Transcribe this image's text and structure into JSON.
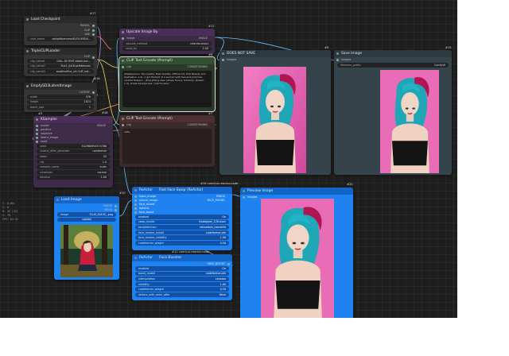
{
  "status_overlay": [
    "T: 0.00s",
    "I: 0",
    "N: 42 [42]",
    "V: 79",
    "FPS: 64.52"
  ],
  "nodes": {
    "load_checkpoint": {
      "id": "#17",
      "title": "Load Checkpoint",
      "outputs": [
        "MODEL",
        "CLIP",
        "VAE"
      ],
      "ckpt_label": "ckpt_name",
      "ckpt_value": "sdxlpdfpersonalXLFLUXSDX...",
      "colors": {
        "accent": "#8a8a8a"
      }
    },
    "triple_clip": {
      "id": "#16",
      "title": "TripleCLIPLoader",
      "output": "CLIP",
      "widgets": [
        {
          "label": "clip_name1",
          "value": "t5XL-1B-TEXT-detail.enc..."
        },
        {
          "label": "clip_name2",
          "value": "flux1_fp16.safetensors"
        },
        {
          "label": "clip_name3",
          "value": "sosdlineflux_vit-CLIP_saf..."
        }
      ]
    },
    "empty_latent": {
      "id": "#18",
      "title": "EmptySD3LatentImage",
      "output": "LATENT",
      "widgets": [
        {
          "label": "width",
          "value": "576"
        },
        {
          "label": "height",
          "value": "1024"
        },
        {
          "label": "batch_size",
          "value": "1"
        }
      ]
    },
    "upscale_by": {
      "id": "#11",
      "title": "Upscale Image By",
      "input": "image",
      "output": "IMAGE",
      "widgets": [
        {
          "label": "upscale_method",
          "value": "nearest-exact"
        },
        {
          "label": "scale_by",
          "value": "2.00"
        }
      ]
    },
    "clip_pos": {
      "id": "#6",
      "title": "CLIP Text Encode (Prompt)",
      "input": "clip",
      "output": "CONDITIONING",
      "text": "(Masterpiece, Top Quality, Best Quality, Official Art, Pink Beauty and Aesthetics: 1.2), 1 girl Portrait of a woman with teal and pink hair, colorful flowers... (Everything else: (sharp focus), full body, (bokeh: 1.4), street background, colorful skin)"
    },
    "clip_neg": {
      "id": "#7",
      "title": "CLIP Text Encode (Prompt)",
      "input": "clip",
      "output": "CONDITIONING",
      "text": "nsfw,"
    },
    "ksampler": {
      "id": "#3",
      "title": "KSampler",
      "inputs": [
        "model",
        "positive",
        "negative",
        "latent_image",
        "seed"
      ],
      "output": "IMAGE",
      "widgets": [
        {
          "label": "seed",
          "value": "542988994374766"
        },
        {
          "label": "control_after_generate",
          "value": "randomize"
        },
        {
          "label": "steps",
          "value": "20"
        },
        {
          "label": "cfg",
          "value": "1.0"
        },
        {
          "label": "sampler_name",
          "value": "euler"
        },
        {
          "label": "scheduler",
          "value": "normal"
        },
        {
          "label": "denoise",
          "value": "1.00"
        }
      ]
    },
    "save_not_save": {
      "id": "#9",
      "title": "DOES NOT SAVE",
      "input": "images"
    },
    "save_image": {
      "id": "#15",
      "title": "Save Image",
      "input": "images",
      "widget": {
        "label": "filename_prefix",
        "value": "ComfyUI"
      }
    },
    "load_image": {
      "id": "#10",
      "title": "Load Image",
      "outputs": [
        "IMAGE",
        "MASK"
      ],
      "widgets": [
        {
          "label": "image",
          "value": "FLUX_00155_.png"
        },
        {
          "label": "",
          "value": "upload"
        }
      ]
    },
    "face_swap": {
      "id": "#16 comfyui-reactor-node",
      "title": "Fast Face Swap (ReActor)",
      "pre": "ReActor",
      "inputs": [
        "input_image",
        "source_image",
        "face_model",
        "options",
        "face_boost"
      ],
      "outputs": [
        "IMAGE",
        "FACE_MODEL"
      ],
      "widgets": [
        {
          "label": "enabled",
          "value": "On"
        },
        {
          "label": "swap_model",
          "value": "inswapper_128.onnx"
        },
        {
          "label": "facedetection",
          "value": "retinaface_resnet50"
        },
        {
          "label": "face_restore_model",
          "value": "codeformer.pth"
        },
        {
          "label": "face_restore_visibility",
          "value": "1.00"
        },
        {
          "label": "codeformer_weight",
          "value": "0.50"
        }
      ],
      "footer_id": "#11 comfyui-reactor-node"
    },
    "face_booster": {
      "id": "",
      "title": "Face Booster",
      "pre": "ReActor",
      "output": "FACE_BOOST",
      "widgets": [
        {
          "label": "enabled",
          "value": "On"
        },
        {
          "label": "boost_model",
          "value": "codeformer.pth"
        },
        {
          "label": "interpolation",
          "value": "Lanczos"
        },
        {
          "label": "visibility",
          "value": "1.00"
        },
        {
          "label": "codeformer_weight",
          "value": "0.50"
        },
        {
          "label": "restore_with_main_after",
          "value": "False"
        }
      ]
    },
    "preview": {
      "id": "#20",
      "title": "Preview Image",
      "input": "images"
    }
  },
  "colors": {
    "canvas": "#1e1e1e",
    "node": "#353535",
    "reactor_blue": "#1e82f0",
    "wire_clip": "#f5d65a",
    "wire_model": "#b09ae8",
    "wire_image": "#66c2ff",
    "wire_cond": "#f0a060",
    "wire_latent": "#ff9ad4",
    "wire_vae": "#ff6b6b"
  }
}
